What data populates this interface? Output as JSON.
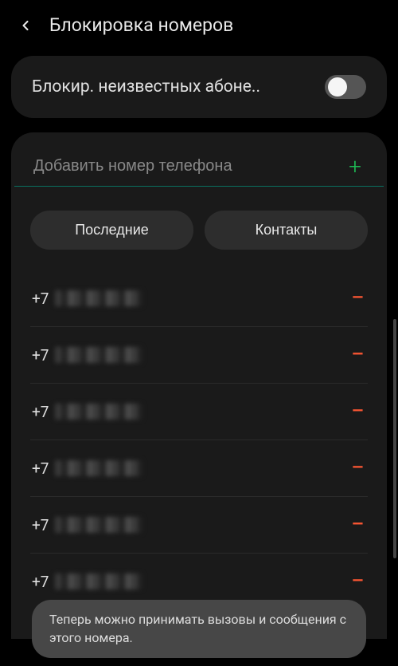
{
  "header": {
    "title": "Блокировка номеров"
  },
  "block_unknown": {
    "label": "Блокир. неизвестных абоне..",
    "enabled": false
  },
  "input": {
    "placeholder": "Добавить номер телефона"
  },
  "buttons": {
    "recent": "Последние",
    "contacts": "Контакты"
  },
  "numbers": [
    {
      "prefix": "+7"
    },
    {
      "prefix": "+7"
    },
    {
      "prefix": "+7"
    },
    {
      "prefix": "+7"
    },
    {
      "prefix": "+7"
    },
    {
      "prefix": "+7"
    }
  ],
  "toast": {
    "message": "Теперь можно принимать вызовы и сообщения с этого номера."
  }
}
